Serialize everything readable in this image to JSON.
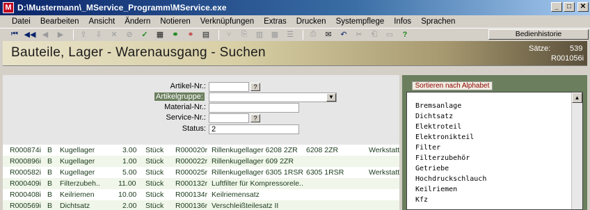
{
  "window": {
    "title": "D:\\Mustermann\\_MService_Programm\\MService.exe",
    "icon": "M"
  },
  "menu": [
    "Datei",
    "Bearbeiten",
    "Ansicht",
    "Ändern",
    "Notieren",
    "Verknüpfungen",
    "Extras",
    "Drucken",
    "Systempflege",
    "Infos",
    "Sprachen"
  ],
  "toolbar": {
    "history_label": "Bedienhistorie",
    "icons": [
      "first-icon",
      "prev-icon",
      "back-icon",
      "forward-icon",
      "export-icon",
      "import-icon",
      "delete-icon",
      "undo-delete-icon",
      "cut-icon",
      "confirm-icon",
      "save-icon",
      "link-icon",
      "unlink-icon",
      "filter-icon",
      "tree-icon",
      "copy-icon",
      "table-icon",
      "print-icon",
      "mail-icon",
      "undo-icon",
      "scissors-icon",
      "paste-icon",
      "clipboard-icon",
      "help-icon"
    ]
  },
  "header": {
    "title": "Bauteile, Lager  -  Warenausgang  -  Suchen",
    "count_label": "Sätze:",
    "count": "539",
    "record_id": "R001056i"
  },
  "form": {
    "artikel_nr_label": "Artikel-Nr.:",
    "artikelgruppe_label": "Artikelgruppe:",
    "material_nr_label": "Material-Nr.:",
    "service_nr_label": "Service-Nr.:",
    "status_label": "Status:",
    "status_value": "2",
    "lookup_button": "?"
  },
  "rows": [
    {
      "id": "R000874i",
      "type": "B",
      "name": "Kugellager",
      "qty": "3.00",
      "unit": "Stück",
      "ref": "R000020r",
      "desc": "Rillenkugellager 6208 2ZR",
      "code": "6208 2ZR",
      "loc": "Werkstatt"
    },
    {
      "id": "R000896i",
      "type": "B",
      "name": "Kugellager",
      "qty": "1.00",
      "unit": "Stück",
      "ref": "R000022r",
      "desc": "Rillenkugellager 609 2ZR",
      "code": "",
      "loc": ""
    },
    {
      "id": "R000582i",
      "type": "B",
      "name": "Kugellager",
      "qty": "5.00",
      "unit": "Stück",
      "ref": "R000025r",
      "desc": "Rillenkugellager 6305 1RSR",
      "code": "6305 1RSR",
      "loc": "Werkstatt"
    },
    {
      "id": "R000409i",
      "type": "B",
      "name": "Filterzubeh..",
      "qty": "11.00",
      "unit": "Stück",
      "ref": "R000132r",
      "desc": "Luftfilter für Kompressorele..",
      "code": "",
      "loc": ""
    },
    {
      "id": "R000408i",
      "type": "B",
      "name": "Keilriemen",
      "qty": "10.00",
      "unit": "Stück",
      "ref": "R000134r",
      "desc": "Keilriemensatz",
      "code": "",
      "loc": ""
    },
    {
      "id": "R000569i",
      "type": "B",
      "name": "Dichtsatz",
      "qty": "2.00",
      "unit": "Stück",
      "ref": "R000136r",
      "desc": "Verschleißteilesatz II",
      "code": "",
      "loc": ""
    }
  ],
  "sidebar": {
    "sort_label": "Sortieren nach Alphabet",
    "items": [
      "Bremsanlage",
      "Dichtsatz",
      "Elektroteil",
      "Elektronikteil",
      "Filter",
      "Filterzubehör",
      "Getriebe",
      "Hochdruckschlauch",
      "Keilriemen",
      "Kfz"
    ]
  },
  "colors": {
    "accent_green": "#6b7f5e",
    "header_brown": "#5a4f3a",
    "titlebar": "#0a246a"
  }
}
